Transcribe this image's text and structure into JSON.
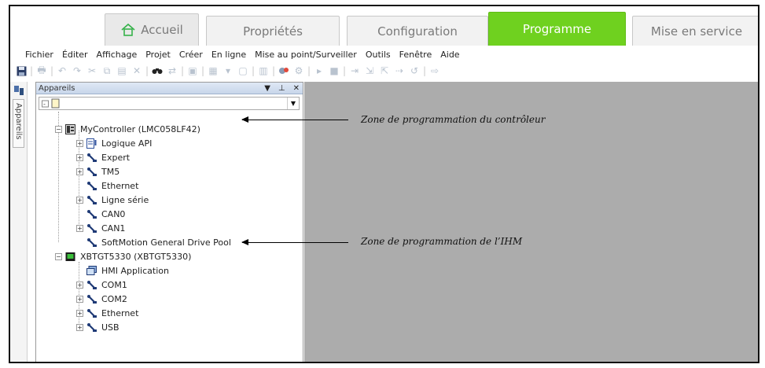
{
  "tabs": [
    {
      "label": "Accueil",
      "icon": "home-icon"
    },
    {
      "label": "Propriétés"
    },
    {
      "label": "Configuration"
    },
    {
      "label": "Programme",
      "active": true
    },
    {
      "label": "Mise en service"
    }
  ],
  "menu": [
    "Fichier",
    "Éditer",
    "Affichage",
    "Projet",
    "Créer",
    "En ligne",
    "Mise au point/Surveiller",
    "Outils",
    "Fenêtre",
    "Aide"
  ],
  "dock": {
    "tab_label": "Appareils"
  },
  "panel": {
    "title": "Appareils",
    "controls": [
      "▼",
      "⊥",
      "✕"
    ]
  },
  "tree": {
    "controller": "MyController (LMC058LF42)",
    "controller_children": [
      "Logique API",
      "Expert",
      "TM5",
      "Ethernet",
      "Ligne série",
      "CAN0",
      "CAN1",
      "SoftMotion General Drive Pool"
    ],
    "hmi": "XBTGT5330 (XBTGT5330)",
    "hmi_children": [
      "HMI Application",
      "COM1",
      "COM2",
      "Ethernet",
      "USB"
    ]
  },
  "annotations": {
    "controller_zone": "Zone de programmation du contrôleur",
    "hmi_zone": "Zone de programmation de l’IHM"
  },
  "colors": {
    "active_tab": "#6fd11f",
    "editor_bg": "#acacac",
    "panel_header": "#c8d6ea"
  }
}
